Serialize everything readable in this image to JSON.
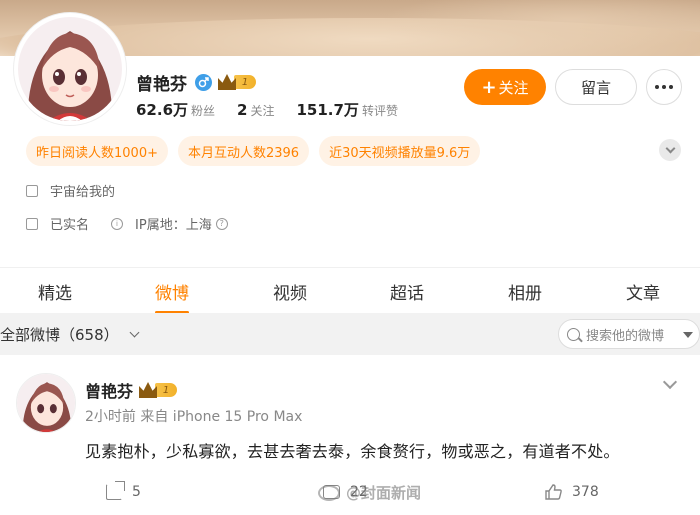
{
  "profile": {
    "name": "曾艳芬",
    "vip_level": "1",
    "stats": [
      {
        "value": "62.6万",
        "label": "粉丝"
      },
      {
        "value": "2",
        "label": "关注"
      },
      {
        "value": "151.7万",
        "label": "转评赞"
      }
    ],
    "follow_label": "关注",
    "message_label": "留言",
    "tags": [
      "昨日阅读人数1000+",
      "本月互动人数2396",
      "近30天视频播放量9.6万"
    ],
    "bio": "宇宙给我的",
    "verified": "已实名",
    "ip_location": "IP属地：上海"
  },
  "tabs": [
    {
      "label": "精选",
      "active": false
    },
    {
      "label": "微博",
      "active": true
    },
    {
      "label": "视频",
      "active": false
    },
    {
      "label": "超话",
      "active": false
    },
    {
      "label": "相册",
      "active": false
    },
    {
      "label": "文章",
      "active": false
    }
  ],
  "filter": {
    "label": "全部微博（658）",
    "search_placeholder": "搜索他的微博"
  },
  "post": {
    "author": "曾艳芬",
    "vip_level": "1",
    "meta": "2小时前  来自 iPhone 15 Pro Max",
    "text": "见素抱朴，少私寡欲，去甚去奢去泰，余食赘行，物或恶之，有道者不处。",
    "reposts": "5",
    "comments": "22",
    "likes": "378"
  },
  "watermark": "@封面新闻",
  "colors": {
    "accent": "#ff8200",
    "gender_badge": "#3f9fe8",
    "vip_gold": "#f2b12a"
  },
  "icons": [
    "male-icon",
    "vip-crown-icon",
    "more-dots-icon",
    "chevron-down-icon",
    "bio-icon",
    "verified-id-icon",
    "ip-icon",
    "help-icon",
    "search-icon",
    "repost-icon",
    "comment-icon",
    "like-icon"
  ]
}
